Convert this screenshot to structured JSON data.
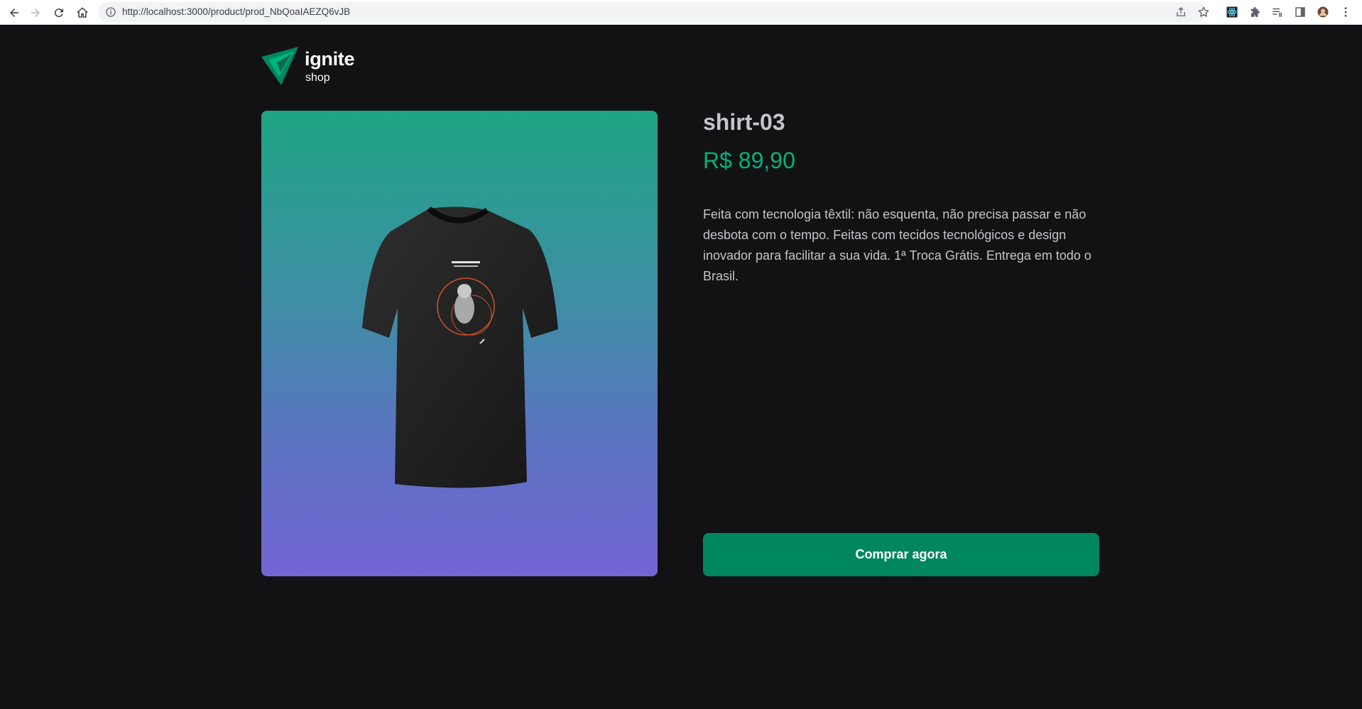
{
  "browser": {
    "url": "http://localhost:3000/product/prod_NbQoaIAEZQ6vJB"
  },
  "header": {
    "logo_title": "ignite",
    "logo_subtitle": "shop"
  },
  "product": {
    "name": "shirt-03",
    "price": "R$ 89,90",
    "description": "Feita com tecnologia têxtil: não esquenta, não precisa passar e não desbota com o tempo. Feitas com tecidos tecnológicos e design inovador para facilitar a sua vida. 1ª Troca Grátis. Entrega em todo o Brasil.",
    "buy_label": "Comprar agora"
  },
  "colors": {
    "background": "#121214",
    "accent": "#00b37e",
    "button": "#00875f",
    "gradient_top": "#1ea483",
    "gradient_bottom": "#7465d4"
  },
  "icons": [
    "back-icon",
    "forward-icon",
    "reload-icon",
    "home-icon",
    "info-icon",
    "share-icon",
    "star-icon",
    "react-devtools-icon",
    "extensions-icon",
    "reading-list-icon",
    "side-panel-icon",
    "profile-avatar",
    "menu-icon"
  ]
}
